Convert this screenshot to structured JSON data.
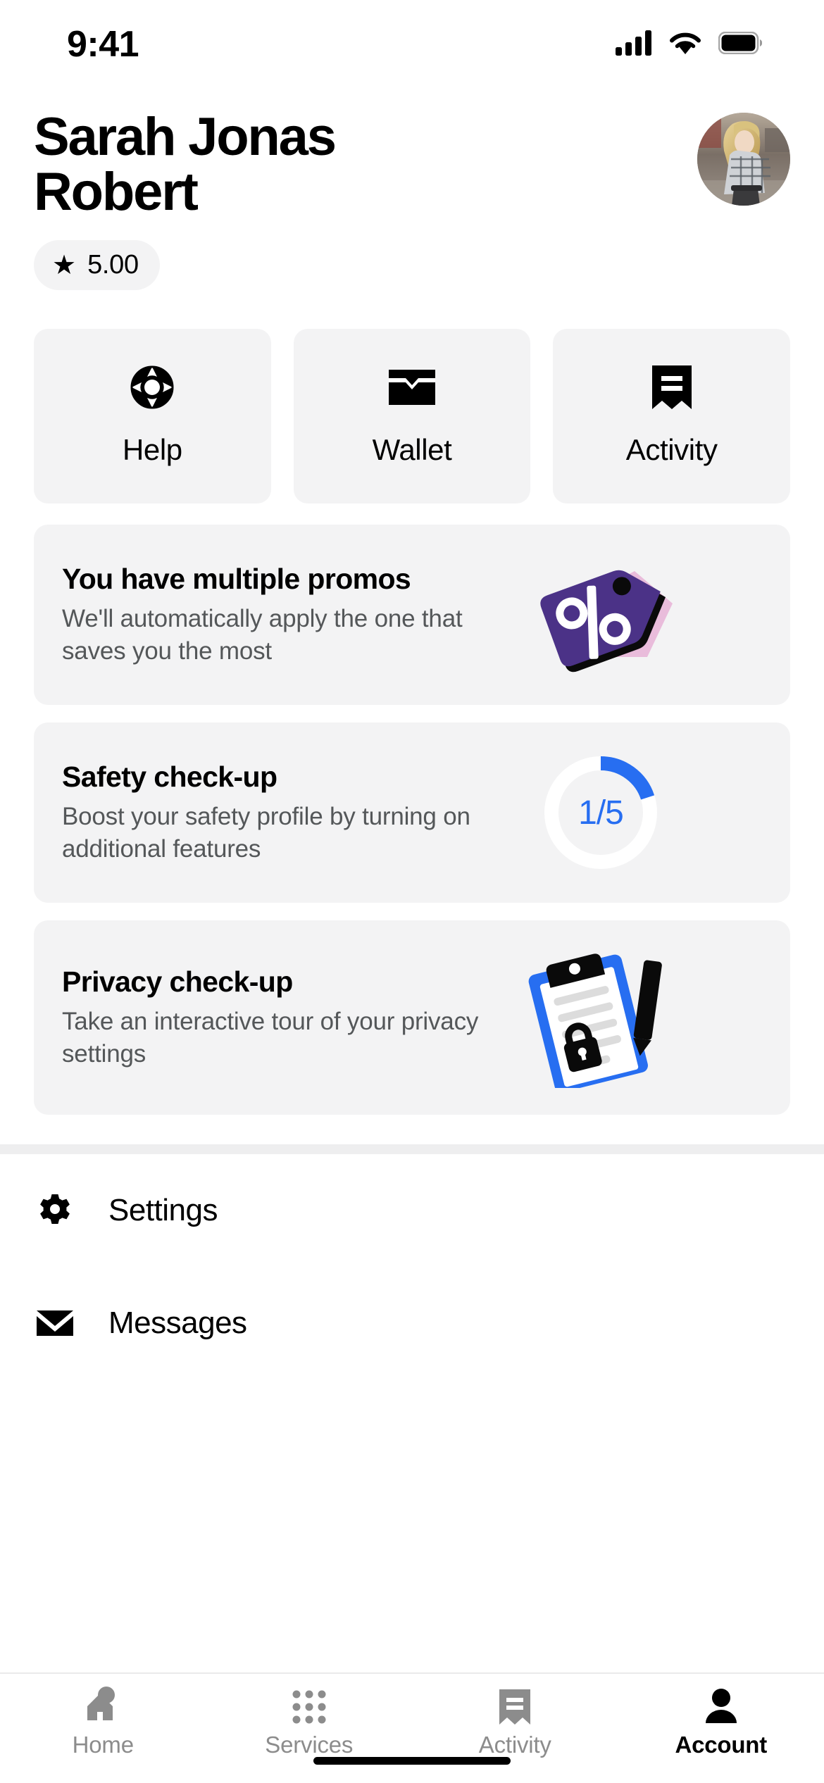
{
  "status_bar": {
    "time": "9:41",
    "signal_icon": "cellular-signal-icon",
    "wifi_icon": "wifi-icon",
    "battery_icon": "battery-icon"
  },
  "header": {
    "user_name": "Sarah Jonas Robert",
    "avatar_icon": "user-avatar-photo",
    "rating": {
      "star_icon": "star-icon",
      "value": "5.00"
    }
  },
  "quick_actions": [
    {
      "label": "Help",
      "icon": "life-ring-icon"
    },
    {
      "label": "Wallet",
      "icon": "wallet-icon"
    },
    {
      "label": "Activity",
      "icon": "receipt-bookmark-icon"
    }
  ],
  "cards": [
    {
      "id": "promos",
      "title": "You have multiple promos",
      "subtitle": "We'll automatically apply the one that saves you the most",
      "art_icon": "promo-tags-illustration",
      "colors": {
        "tag_front": "#4B3287",
        "tag_back": "#E9BCDB",
        "percent": "#FFFFFF"
      }
    },
    {
      "id": "safety-check-up",
      "title": "Safety check-up",
      "subtitle": "Boost your safety profile by turning on additional features",
      "art_icon": "progress-ring",
      "progress": {
        "current": 1,
        "total": 5,
        "label": "1/5",
        "color": "#276EF1",
        "track": "#FFFFFF"
      }
    },
    {
      "id": "privacy-check-up",
      "title": "Privacy check-up",
      "subtitle": "Take an interactive tour of your privacy settings",
      "art_icon": "clipboard-lock-illustration",
      "colors": {
        "board": "#276EF1",
        "paper": "#FFFFFF",
        "clip": "#0A0A0A",
        "lines": "#DCDCDC"
      }
    }
  ],
  "menu": [
    {
      "label": "Settings",
      "icon": "gear-icon"
    },
    {
      "label": "Messages",
      "icon": "envelope-icon"
    }
  ],
  "tab_bar": [
    {
      "label": "Home",
      "icon": "home-icon",
      "active": false
    },
    {
      "label": "Services",
      "icon": "grid-dots-icon",
      "active": false
    },
    {
      "label": "Activity",
      "icon": "receipt-bookmark-icon",
      "active": false
    },
    {
      "label": "Account",
      "icon": "person-icon",
      "active": true
    }
  ],
  "theme": {
    "card_bg": "#F3F3F4",
    "accent_blue": "#276EF1",
    "text_primary": "#000000",
    "text_secondary": "#545759",
    "tab_inactive": "#8C8C8C"
  }
}
